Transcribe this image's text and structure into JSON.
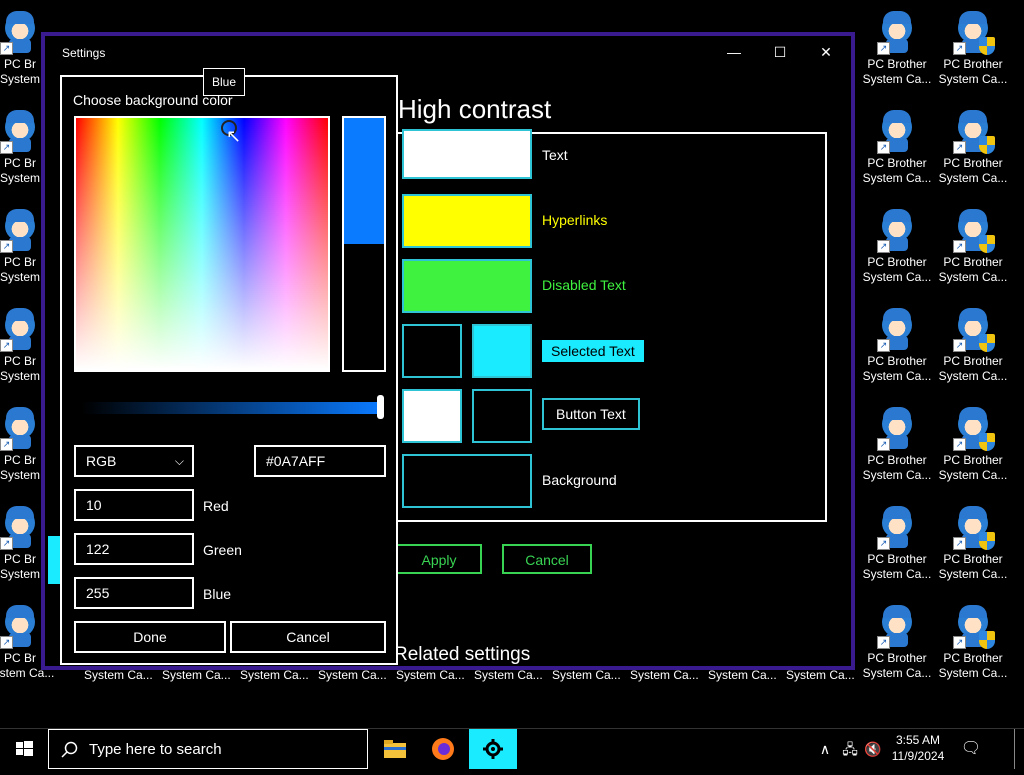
{
  "desktop": {
    "icon_label_line1": "PC Brother",
    "icon_label_line2": "System Ca...",
    "left_icon_line1": "PC Br",
    "left_icon_line2": "System",
    "left_icon_last_line1": "PC Br",
    "left_icon_last_line2": "System Ca...",
    "bottom_row_label": "System Ca..."
  },
  "settings_window": {
    "title": "Settings",
    "minimize_glyph": "—",
    "maximize_glyph": "☐",
    "close_glyph": "✕",
    "heading": "High contrast",
    "swatches": {
      "text": {
        "label": "Text",
        "color": "#ffffff"
      },
      "hyperlinks": {
        "label": "Hyperlinks",
        "color": "#ffff00"
      },
      "disabled_text": {
        "label": "Disabled Text",
        "color": "#3ff23f"
      },
      "selected_text": {
        "label": "Selected Text",
        "fg_color": "#000000",
        "bg_color": "#1aebff"
      },
      "button_text": {
        "label": "Button Text",
        "fg_color": "#ffffff",
        "bg_color": "#000000"
      },
      "background": {
        "label": "Background",
        "color": "#000000"
      }
    },
    "apply_label": "Apply",
    "cancel_label": "Cancel",
    "related_settings": "Related settings"
  },
  "color_picker": {
    "title": "Choose background color",
    "tooltip": "Blue",
    "mode": "RGB",
    "hex_value": "#0A7AFF",
    "red_value": "10",
    "red_label": "Red",
    "green_value": "122",
    "green_label": "Green",
    "blue_value": "255",
    "blue_label": "Blue",
    "done_label": "Done",
    "cancel_label": "Cancel",
    "selected_color": "#0a7aff"
  },
  "taskbar": {
    "search_placeholder": "Type here to search",
    "time": "3:55 AM",
    "date": "11/9/2024"
  }
}
